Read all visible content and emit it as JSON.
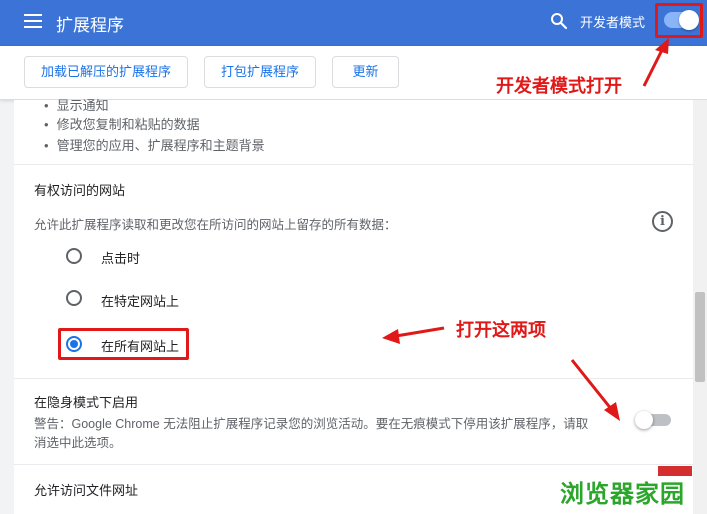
{
  "header": {
    "title": "扩展程序",
    "dev_mode_label": "开发者模式",
    "dev_mode_on": true
  },
  "toolbar": {
    "load_unpacked": "加载已解压的扩展程序",
    "pack": "打包扩展程序",
    "update": "更新"
  },
  "annotations": {
    "dev_mode_open": "开发者模式打开",
    "open_these_two": "打开这两项"
  },
  "permissions": {
    "items": [
      "显示通知",
      "修改您复制和粘贴的数据",
      "管理您的应用、扩展程序和主题背景"
    ]
  },
  "site_access": {
    "title": "有权访问的网站",
    "description": "允许此扩展程序读取和更改您在所访问的网站上留存的所有数据：",
    "options": [
      {
        "label": "点击时",
        "checked": false
      },
      {
        "label": "在特定网站上",
        "checked": false
      },
      {
        "label": "在所有网站上",
        "checked": true
      }
    ]
  },
  "incognito": {
    "title": "在隐身模式下启用",
    "warning_line1": "警告：Google Chrome 无法阻止扩展程序记录您的浏览活动。要在无痕模式下停用该扩展程序，请取",
    "warning_line2": "消选中此选项。",
    "enabled": false
  },
  "file_urls": {
    "title": "允许访问文件网址"
  },
  "watermark": "浏览器家园",
  "colors": {
    "header_bg": "#3b73d6",
    "accent": "#1a73e8",
    "annotation_red": "#e01818",
    "watermark_green": "#2aa62a"
  }
}
